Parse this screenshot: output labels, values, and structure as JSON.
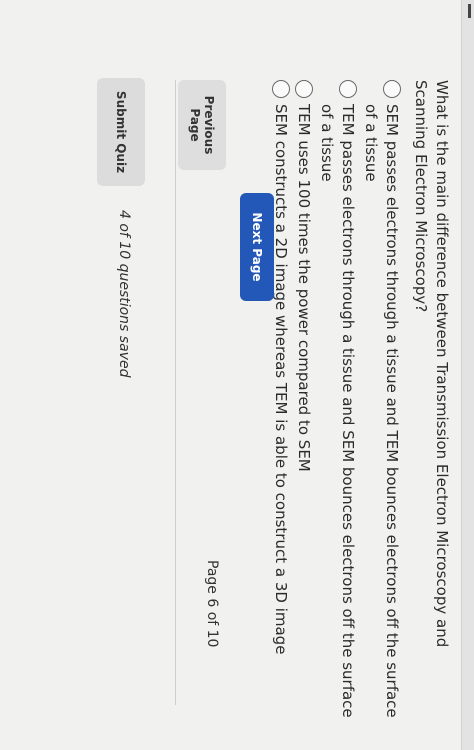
{
  "question": {
    "text": "What is the main difference between Transmission Electron Microscopy and Scanning Electron Microscopy?"
  },
  "options": [
    {
      "label": "SEM passes electrons through a tissue and TEM bounces electrons off the surface of a tissue"
    },
    {
      "label": "TEM passes electrons through a tissue and SEM bounces electrons off the surface of a tissue"
    },
    {
      "label": "TEM uses 100 times the power compared to SEM"
    },
    {
      "label": "SEM constructs a 2D image whereas TEM is able to construct a 3D image"
    }
  ],
  "navigation": {
    "previous_label": "Previous Page",
    "next_label": "Next Page",
    "page_indicator": "Page 6 of 10"
  },
  "footer": {
    "submit_label": "Submit Quiz",
    "saved_status": "4 of 10 questions saved"
  },
  "colors": {
    "primary_button": "#2458b8",
    "secondary_button": "#dedede",
    "background": "#f1f1f0"
  }
}
